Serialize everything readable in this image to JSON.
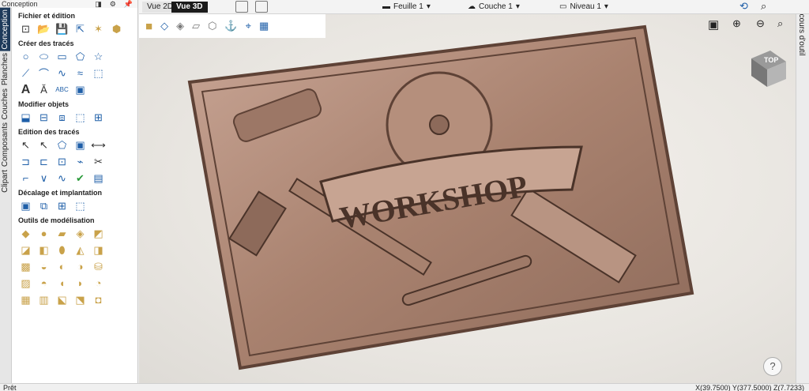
{
  "panel": {
    "header": "Conception",
    "sections": {
      "file_edit": "Fichier et édition",
      "create": "Créer des tracés",
      "modify": "Modifier objets",
      "edit": "Edition des tracés",
      "offset": "Décalage et implantation",
      "modeling": "Outils de modélisation"
    }
  },
  "left_tabs": [
    "Conception",
    "Planches",
    "Couches",
    "Composants",
    "Clipart"
  ],
  "view_tabs": {
    "v2d": "Vue 2D",
    "v3d": "Vue 3D"
  },
  "dropdowns": {
    "sheet": "Feuille 1",
    "layer": "Couche 1",
    "level": "Niveau 1"
  },
  "right_tab": "Parcours d'outil",
  "model": {
    "title": "WORKSHOP"
  },
  "viewcube": {
    "label": "TOP"
  },
  "help": "?",
  "status": {
    "left": "Prêt",
    "coords": "X(39.7500) Y(377.5000) Z(7.7233)"
  },
  "colors": {
    "model_base": "#b08a78",
    "model_dark": "#5e4236",
    "active_tab": "#1e3a5a"
  }
}
